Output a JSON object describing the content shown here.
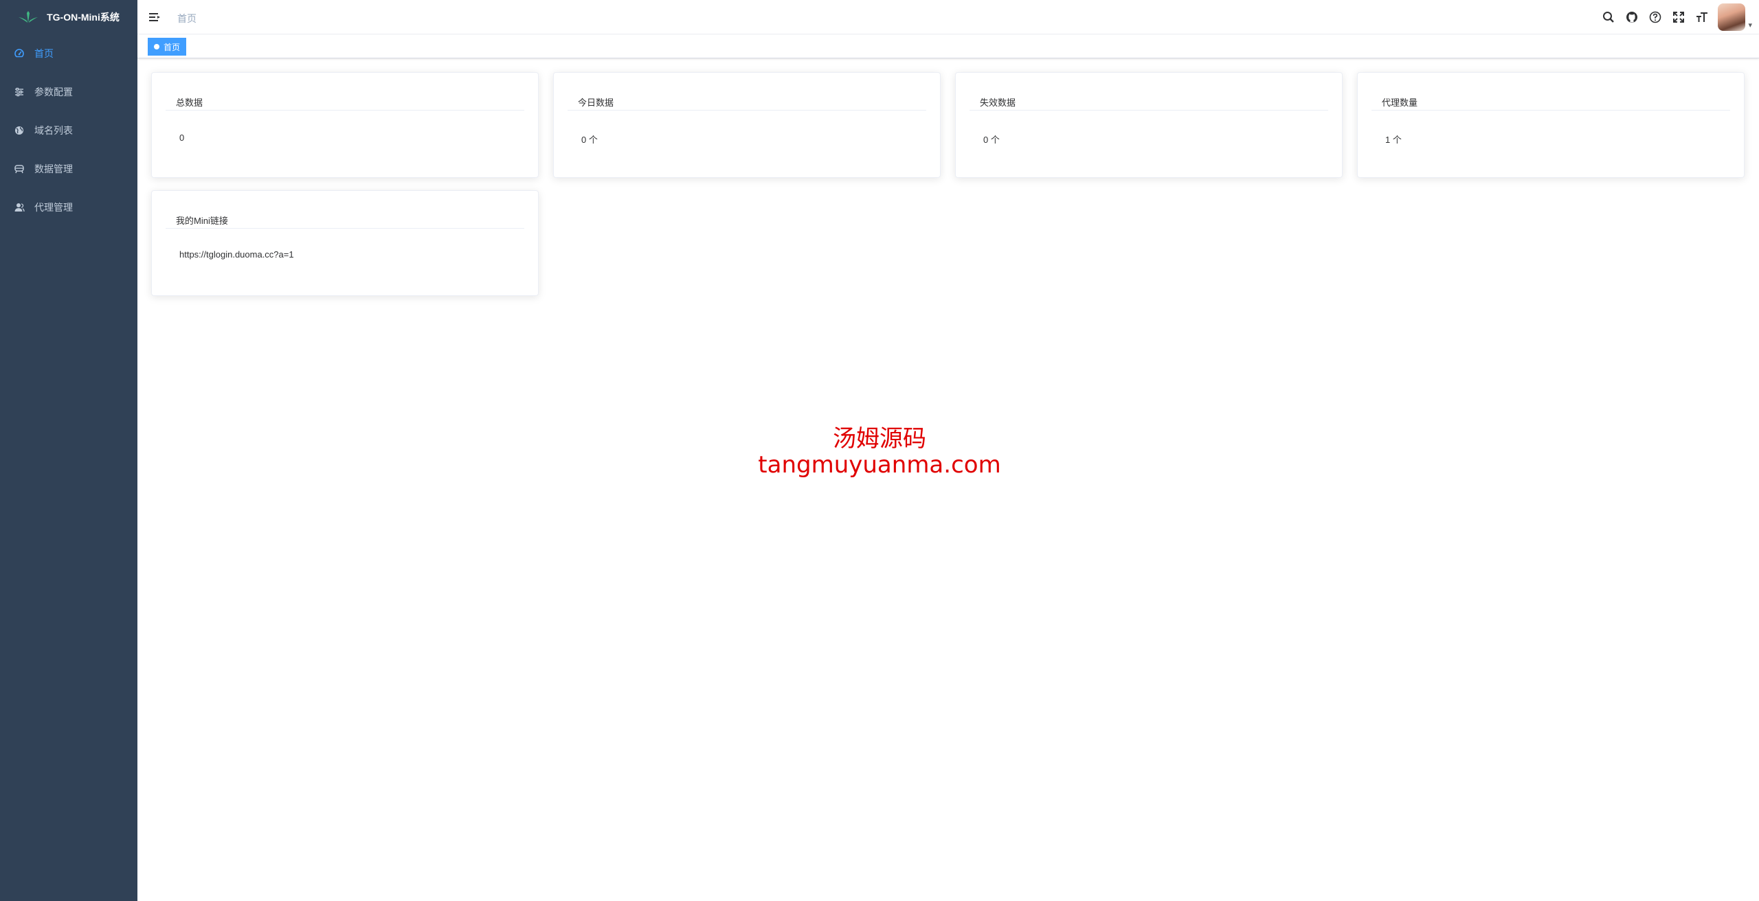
{
  "app": {
    "title": "TG-ON-Mini系统"
  },
  "sidebar": {
    "items": [
      {
        "label": "首页",
        "icon": "dashboard-icon",
        "active": true
      },
      {
        "label": "参数配置",
        "icon": "sliders-icon",
        "active": false
      },
      {
        "label": "域名列表",
        "icon": "globe-icon",
        "active": false
      },
      {
        "label": "数据管理",
        "icon": "database-icon",
        "active": false
      },
      {
        "label": "代理管理",
        "icon": "user-icon",
        "active": false
      }
    ]
  },
  "navbar": {
    "breadcrumb": "首页",
    "icons": [
      "search-icon",
      "github-icon",
      "help-icon",
      "fullscreen-icon",
      "font-size-icon"
    ]
  },
  "tags_view": {
    "active_tag": "首页"
  },
  "cards": [
    {
      "title": "总数据",
      "value": "0"
    },
    {
      "title": "今日数据",
      "value": "0 个"
    },
    {
      "title": "失效数据",
      "value": "0 个"
    },
    {
      "title": "代理数量",
      "value": "1 个"
    },
    {
      "title": "我的Mini链接",
      "value": "https://tglogin.duoma.cc?a=1"
    }
  ],
  "watermark": {
    "line1": "汤姆源码",
    "line2": "tangmuyuanma.com"
  },
  "colors": {
    "sidebar_bg": "#304156",
    "accent": "#409eff",
    "sidebar_text": "#bfcbd9",
    "watermark": "#e00000"
  }
}
